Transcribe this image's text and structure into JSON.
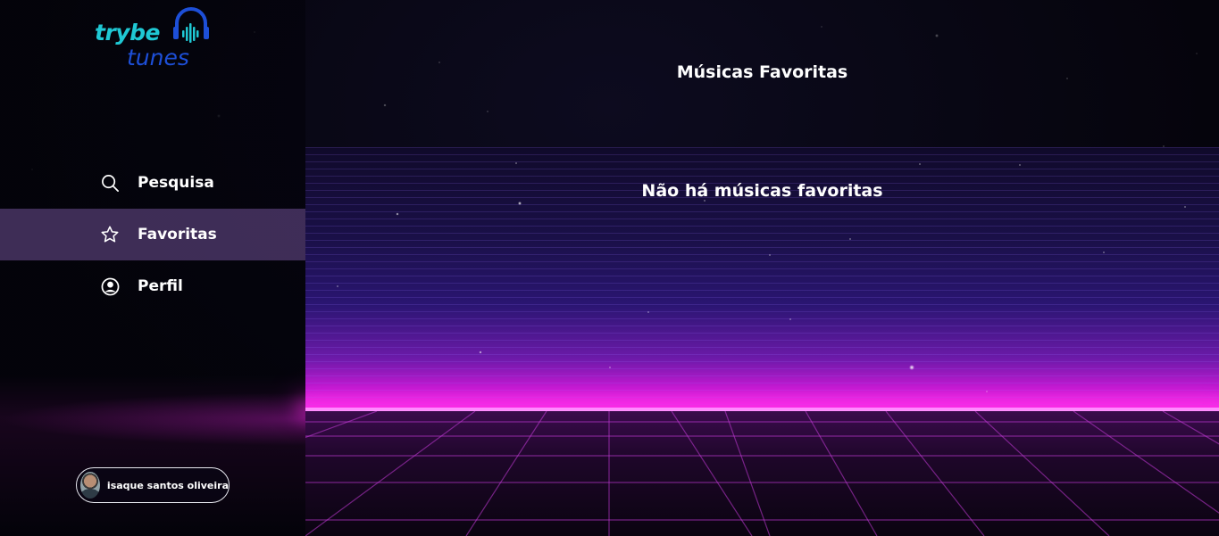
{
  "app": {
    "logo": {
      "word1": "trybe",
      "word2": "tunes"
    },
    "page_title": "Músicas Favoritas",
    "empty_message": "Não há músicas favoritas"
  },
  "sidebar": {
    "items": [
      {
        "label": "Pesquisa",
        "icon": "search-icon",
        "active": false
      },
      {
        "label": "Favoritas",
        "icon": "star-icon",
        "active": true
      },
      {
        "label": "Perfil",
        "icon": "user-circle-icon",
        "active": false
      }
    ],
    "user": {
      "name": "isaque santos oliveira",
      "avatar_icon": "avatar"
    }
  },
  "colors": {
    "logo_trybe": "#1fc8d4",
    "logo_tunes": "#1d4fd8",
    "active_nav": "#705096",
    "horizon": "#ff3bf0"
  }
}
